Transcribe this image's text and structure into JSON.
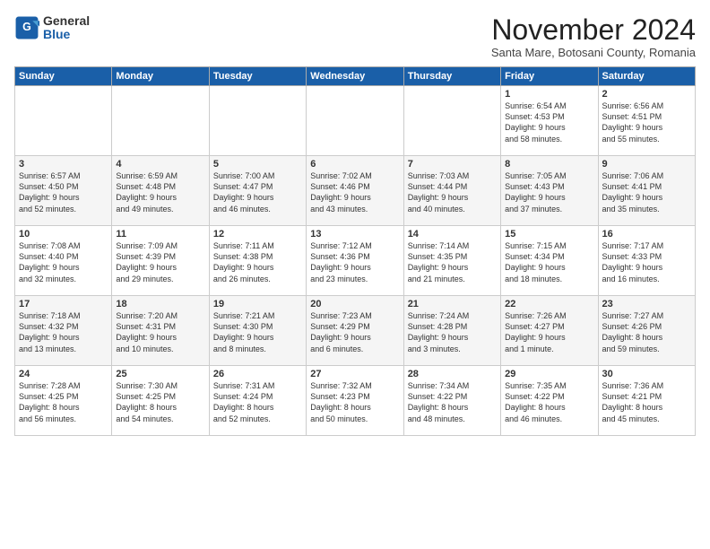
{
  "logo": {
    "general": "General",
    "blue": "Blue"
  },
  "title": "November 2024",
  "subtitle": "Santa Mare, Botosani County, Romania",
  "headers": [
    "Sunday",
    "Monday",
    "Tuesday",
    "Wednesday",
    "Thursday",
    "Friday",
    "Saturday"
  ],
  "weeks": [
    [
      {
        "day": "",
        "info": ""
      },
      {
        "day": "",
        "info": ""
      },
      {
        "day": "",
        "info": ""
      },
      {
        "day": "",
        "info": ""
      },
      {
        "day": "",
        "info": ""
      },
      {
        "day": "1",
        "info": "Sunrise: 6:54 AM\nSunset: 4:53 PM\nDaylight: 9 hours\nand 58 minutes."
      },
      {
        "day": "2",
        "info": "Sunrise: 6:56 AM\nSunset: 4:51 PM\nDaylight: 9 hours\nand 55 minutes."
      }
    ],
    [
      {
        "day": "3",
        "info": "Sunrise: 6:57 AM\nSunset: 4:50 PM\nDaylight: 9 hours\nand 52 minutes."
      },
      {
        "day": "4",
        "info": "Sunrise: 6:59 AM\nSunset: 4:48 PM\nDaylight: 9 hours\nand 49 minutes."
      },
      {
        "day": "5",
        "info": "Sunrise: 7:00 AM\nSunset: 4:47 PM\nDaylight: 9 hours\nand 46 minutes."
      },
      {
        "day": "6",
        "info": "Sunrise: 7:02 AM\nSunset: 4:46 PM\nDaylight: 9 hours\nand 43 minutes."
      },
      {
        "day": "7",
        "info": "Sunrise: 7:03 AM\nSunset: 4:44 PM\nDaylight: 9 hours\nand 40 minutes."
      },
      {
        "day": "8",
        "info": "Sunrise: 7:05 AM\nSunset: 4:43 PM\nDaylight: 9 hours\nand 37 minutes."
      },
      {
        "day": "9",
        "info": "Sunrise: 7:06 AM\nSunset: 4:41 PM\nDaylight: 9 hours\nand 35 minutes."
      }
    ],
    [
      {
        "day": "10",
        "info": "Sunrise: 7:08 AM\nSunset: 4:40 PM\nDaylight: 9 hours\nand 32 minutes."
      },
      {
        "day": "11",
        "info": "Sunrise: 7:09 AM\nSunset: 4:39 PM\nDaylight: 9 hours\nand 29 minutes."
      },
      {
        "day": "12",
        "info": "Sunrise: 7:11 AM\nSunset: 4:38 PM\nDaylight: 9 hours\nand 26 minutes."
      },
      {
        "day": "13",
        "info": "Sunrise: 7:12 AM\nSunset: 4:36 PM\nDaylight: 9 hours\nand 23 minutes."
      },
      {
        "day": "14",
        "info": "Sunrise: 7:14 AM\nSunset: 4:35 PM\nDaylight: 9 hours\nand 21 minutes."
      },
      {
        "day": "15",
        "info": "Sunrise: 7:15 AM\nSunset: 4:34 PM\nDaylight: 9 hours\nand 18 minutes."
      },
      {
        "day": "16",
        "info": "Sunrise: 7:17 AM\nSunset: 4:33 PM\nDaylight: 9 hours\nand 16 minutes."
      }
    ],
    [
      {
        "day": "17",
        "info": "Sunrise: 7:18 AM\nSunset: 4:32 PM\nDaylight: 9 hours\nand 13 minutes."
      },
      {
        "day": "18",
        "info": "Sunrise: 7:20 AM\nSunset: 4:31 PM\nDaylight: 9 hours\nand 10 minutes."
      },
      {
        "day": "19",
        "info": "Sunrise: 7:21 AM\nSunset: 4:30 PM\nDaylight: 9 hours\nand 8 minutes."
      },
      {
        "day": "20",
        "info": "Sunrise: 7:23 AM\nSunset: 4:29 PM\nDaylight: 9 hours\nand 6 minutes."
      },
      {
        "day": "21",
        "info": "Sunrise: 7:24 AM\nSunset: 4:28 PM\nDaylight: 9 hours\nand 3 minutes."
      },
      {
        "day": "22",
        "info": "Sunrise: 7:26 AM\nSunset: 4:27 PM\nDaylight: 9 hours\nand 1 minute."
      },
      {
        "day": "23",
        "info": "Sunrise: 7:27 AM\nSunset: 4:26 PM\nDaylight: 8 hours\nand 59 minutes."
      }
    ],
    [
      {
        "day": "24",
        "info": "Sunrise: 7:28 AM\nSunset: 4:25 PM\nDaylight: 8 hours\nand 56 minutes."
      },
      {
        "day": "25",
        "info": "Sunrise: 7:30 AM\nSunset: 4:25 PM\nDaylight: 8 hours\nand 54 minutes."
      },
      {
        "day": "26",
        "info": "Sunrise: 7:31 AM\nSunset: 4:24 PM\nDaylight: 8 hours\nand 52 minutes."
      },
      {
        "day": "27",
        "info": "Sunrise: 7:32 AM\nSunset: 4:23 PM\nDaylight: 8 hours\nand 50 minutes."
      },
      {
        "day": "28",
        "info": "Sunrise: 7:34 AM\nSunset: 4:22 PM\nDaylight: 8 hours\nand 48 minutes."
      },
      {
        "day": "29",
        "info": "Sunrise: 7:35 AM\nSunset: 4:22 PM\nDaylight: 8 hours\nand 46 minutes."
      },
      {
        "day": "30",
        "info": "Sunrise: 7:36 AM\nSunset: 4:21 PM\nDaylight: 8 hours\nand 45 minutes."
      }
    ]
  ]
}
